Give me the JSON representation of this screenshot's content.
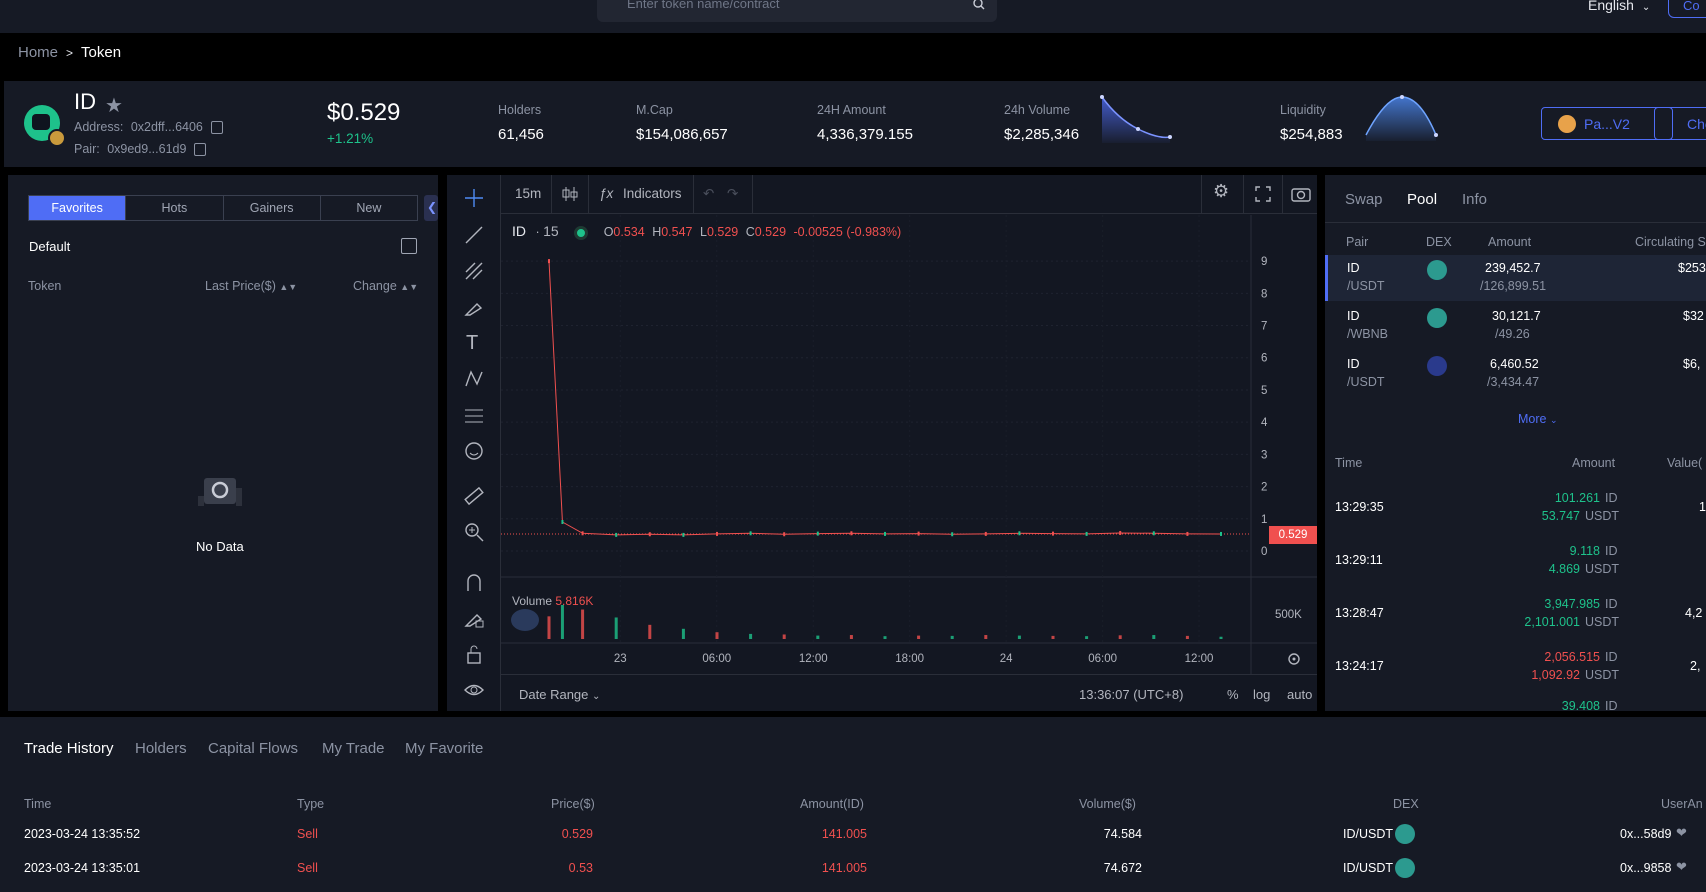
{
  "topbar": {
    "search_placeholder": "Enter token name/contract",
    "language": "English",
    "right_button": "Co"
  },
  "breadcrumb": {
    "home": "Home",
    "current": "Token"
  },
  "token": {
    "symbol": "ID",
    "address_label": "Address:",
    "address": "0x2dff...6406",
    "pair_label": "Pair:",
    "pair": "0x9ed9...61d9",
    "price": "$0.529",
    "change": "+1.21%"
  },
  "stats": [
    {
      "label": "Holders",
      "value": "61,456"
    },
    {
      "label": "M.Cap",
      "value": "$154,086,657"
    },
    {
      "label": "24H Amount",
      "value": "4,336,379.155"
    },
    {
      "label": "24h Volume",
      "value": "$2,285,346"
    },
    {
      "label": "Liquidity",
      "value": "$254,883"
    }
  ],
  "header_buttons": {
    "pair_version": "Pa...V2",
    "check": "Chec"
  },
  "watchlist": {
    "tabs": [
      "Favorites",
      "Hots",
      "Gainers",
      "New"
    ],
    "group": "Default",
    "columns": {
      "token": "Token",
      "last_price": "Last Price($)",
      "change": "Change"
    },
    "empty": "No Data"
  },
  "chart_toolbar": {
    "interval": "15m",
    "indicators": "Indicators"
  },
  "chart_legend": {
    "symbol": "ID",
    "interval": "15",
    "o": "0.534",
    "h": "0.547",
    "l": "0.529",
    "c": "0.529",
    "change": "-0.00525 (-0.983%)"
  },
  "chart_footer": {
    "date_range": "Date Range",
    "time": "13:36:07 (UTC+8)",
    "pct": "%",
    "log": "log",
    "auto": "auto"
  },
  "volume": {
    "label": "Volume",
    "value": "5.816K",
    "axis": "500K"
  },
  "colors": {
    "accent": "#4f6df5",
    "up": "#1ec28b",
    "down": "#f0504f",
    "panel": "#161a25"
  },
  "chart_data": {
    "type": "line",
    "title": "",
    "y_ticks": [
      "9",
      "8",
      "7",
      "6",
      "5",
      "4",
      "3",
      "2",
      "1",
      "0"
    ],
    "x_ticks": [
      "23",
      "06:00",
      "12:00",
      "18:00",
      "24",
      "06:00",
      "12:00"
    ],
    "last_price_tag": "0.529",
    "ylim": [
      0,
      9.5
    ],
    "x": [
      0,
      0.02,
      0.05,
      0.1,
      0.15,
      0.2,
      0.25,
      0.3,
      0.35,
      0.4,
      0.45,
      0.5,
      0.55,
      0.6,
      0.65,
      0.7,
      0.75,
      0.8,
      0.85,
      0.9,
      0.95,
      1.0
    ],
    "series": [
      {
        "values": [
          9.0,
          0.9,
          0.55,
          0.5,
          0.52,
          0.5,
          0.53,
          0.55,
          0.52,
          0.54,
          0.55,
          0.53,
          0.54,
          0.52,
          0.53,
          0.55,
          0.54,
          0.53,
          0.56,
          0.55,
          0.53,
          0.529
        ]
      }
    ],
    "volume": [
      400,
      600,
      520,
      380,
      250,
      180,
      120,
      90,
      80,
      60,
      70,
      50,
      60,
      55,
      70,
      60,
      55,
      50,
      65,
      70,
      55,
      40
    ]
  },
  "right_panel": {
    "tabs": [
      "Swap",
      "Pool",
      "Info"
    ],
    "pool_headers": {
      "pair": "Pair",
      "dex": "DEX",
      "amount": "Amount",
      "circ": "Circulating S"
    },
    "pools": [
      {
        "base": "ID",
        "quote": "/USDT",
        "amount": "239,452.7",
        "amount2": "/126,899.51",
        "circ": "$253"
      },
      {
        "base": "ID",
        "quote": "/WBNB",
        "amount": "30,121.7",
        "amount2": "/49.26",
        "circ": "$32"
      },
      {
        "base": "ID",
        "quote": "/USDT",
        "amount": "6,460.52",
        "amount2": "/3,434.47",
        "circ": "$6,"
      }
    ],
    "more": "More",
    "trade_headers": {
      "time": "Time",
      "amount": "Amount",
      "value": "Value("
    },
    "trades": [
      {
        "time": "13:29:35",
        "a1": "101.261",
        "u1": "ID",
        "a2": "53.747",
        "u2": "USDT",
        "value": "1",
        "side": "buy"
      },
      {
        "time": "13:29:11",
        "a1": "9.118",
        "u1": "ID",
        "a2": "4.869",
        "u2": "USDT",
        "value": "",
        "side": "buy"
      },
      {
        "time": "13:28:47",
        "a1": "3,947.985",
        "u1": "ID",
        "a2": "2,101.001",
        "u2": "USDT",
        "value": "4,2",
        "side": "buy"
      },
      {
        "time": "13:24:17",
        "a1": "2,056.515",
        "u1": "ID",
        "a2": "1,092.92",
        "u2": "USDT",
        "value": "2,",
        "side": "sell"
      },
      {
        "time": "",
        "a1": "39.408",
        "u1": "ID",
        "a2": "",
        "u2": "",
        "value": "",
        "side": "buy"
      }
    ]
  },
  "bottom": {
    "tabs": [
      "Trade History",
      "Holders",
      "Capital Flows",
      "My Trade",
      "My Favorite"
    ],
    "headers": {
      "time": "Time",
      "type": "Type",
      "price": "Price($)",
      "amount": "Amount(ID)",
      "volume": "Volume($)",
      "dex": "DEX",
      "user": "UserAn"
    },
    "rows": [
      {
        "time": "2023-03-24 13:35:52",
        "type": "Sell",
        "price": "0.529",
        "amount": "141.005",
        "volume": "74.584",
        "dex": "ID/USDT",
        "user": "0x...58d9"
      },
      {
        "time": "2023-03-24 13:35:01",
        "type": "Sell",
        "price": "0.53",
        "amount": "141.005",
        "volume": "74.672",
        "dex": "ID/USDT",
        "user": "0x...9858"
      }
    ]
  }
}
